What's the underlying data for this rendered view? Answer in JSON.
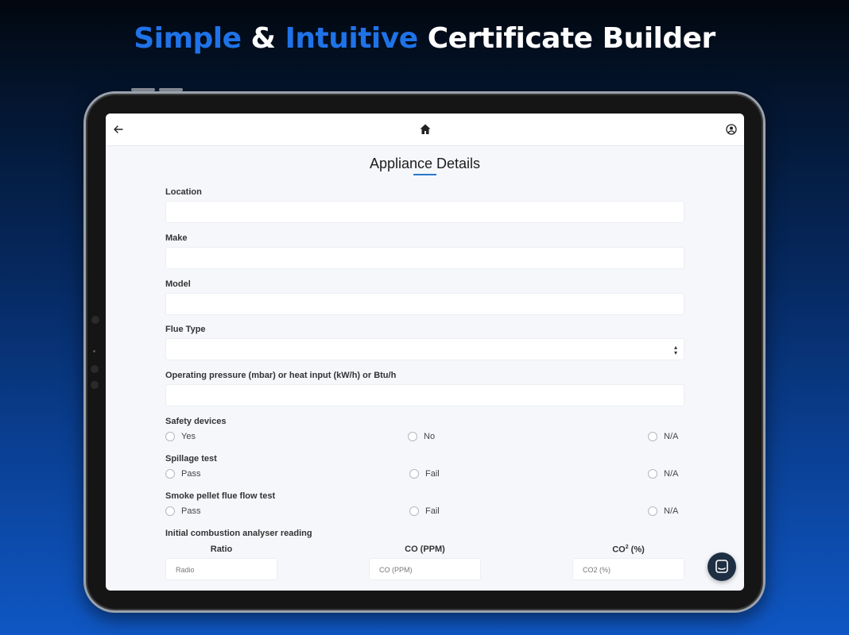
{
  "headline": {
    "word1": "Simple",
    "amp": "&",
    "word2": "Intuitive",
    "rest": "Certificate Builder"
  },
  "colors": {
    "accent": "#1f73e8",
    "underline": "#2b78c9",
    "chat_button": "#1f2f43"
  },
  "nav": {
    "back_icon": "arrow-left-icon",
    "home_icon": "home-icon",
    "profile_icon": "user-circle-icon"
  },
  "page": {
    "title": "Appliance Details"
  },
  "fields": {
    "location": {
      "label": "Location",
      "value": ""
    },
    "make": {
      "label": "Make",
      "value": ""
    },
    "model": {
      "label": "Model",
      "value": ""
    },
    "flue_type": {
      "label": "Flue Type",
      "value": ""
    },
    "operating_pressure": {
      "label": "Operating pressure (mbar) or heat input (kW/h) or Btu/h",
      "value": ""
    }
  },
  "radio_groups": {
    "safety_devices": {
      "label": "Safety devices",
      "options": [
        "Yes",
        "No",
        "N/A"
      ]
    },
    "spillage_test": {
      "label": "Spillage test",
      "options": [
        "Pass",
        "Fail",
        "N/A"
      ]
    },
    "smoke_pellet": {
      "label": "Smoke pellet flue flow test",
      "options": [
        "Pass",
        "Fail",
        "N/A"
      ]
    }
  },
  "combustion": {
    "label": "Initial combustion analyser reading",
    "ratio": {
      "header": "Ratio",
      "placeholder": "Radio"
    },
    "co": {
      "header": "CO (PPM)",
      "placeholder": "CO (PPM)"
    },
    "co2": {
      "header": "CO",
      "sup": "2",
      "suffix": " (%)",
      "placeholder": "CO2 (%)"
    }
  },
  "chat": {
    "icon": "chat-icon"
  }
}
